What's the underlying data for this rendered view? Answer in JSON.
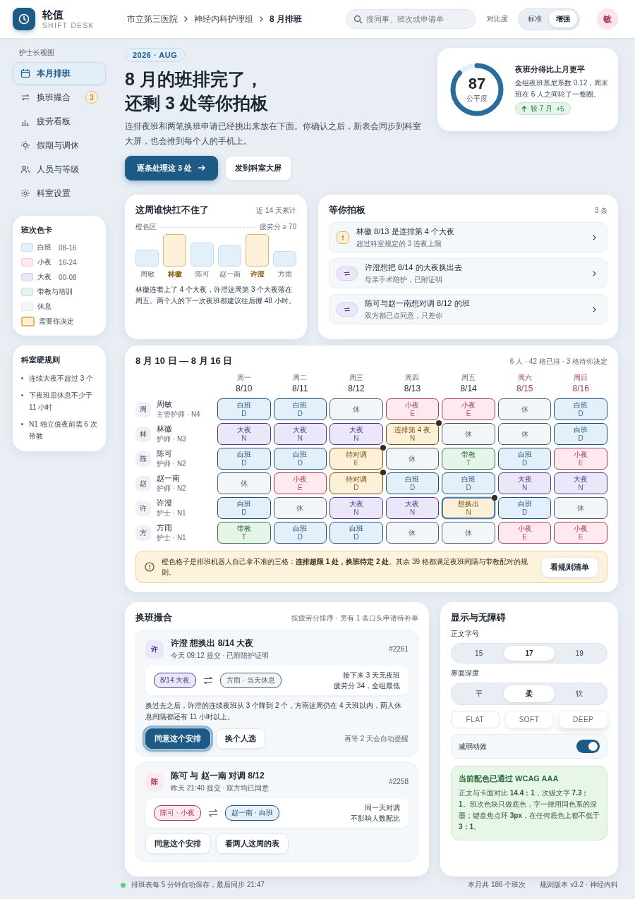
{
  "header": {
    "app_name": "轮值",
    "app_subtitle": "SHIFT DESK",
    "breadcrumbs": [
      "市立第三医院",
      "神经内科护理组",
      "8 月排班"
    ],
    "search": {
      "placeholder": "搜同事、班次或申请单"
    },
    "contrast_label": "对比度",
    "contrast_options": [
      {
        "label": "标准",
        "selected": false
      },
      {
        "label": "增强",
        "selected": true
      }
    ],
    "avatar": "敏"
  },
  "sidebar": {
    "section_label": "护士长视图",
    "nav": [
      {
        "label": "本月排班",
        "selected": true
      },
      {
        "label": "换班撮合",
        "selected": false,
        "badge": "3"
      },
      {
        "label": "疲劳看板",
        "selected": false
      },
      {
        "label": "假期与调休",
        "selected": false
      },
      {
        "label": "人员与等级",
        "selected": false
      },
      {
        "label": "科室设置",
        "selected": false
      }
    ],
    "legend": {
      "title": "班次色卡",
      "items": [
        {
          "kind": "day",
          "label": "白班",
          "hours": "08-16"
        },
        {
          "kind": "evening",
          "label": "小夜",
          "hours": "16-24"
        },
        {
          "kind": "night",
          "label": "大夜",
          "hours": "00-08"
        },
        {
          "kind": "teach",
          "label": "带教与培训"
        },
        {
          "kind": "rest",
          "label": "休息"
        },
        {
          "kind": "decide",
          "label": "需要你决定"
        }
      ]
    },
    "rules": {
      "title": "科室硬规则",
      "items": [
        "连续大夜不超过 3 个",
        "下夜班后休息不少于 11 小时",
        "N1 独立值夜前需 6 次带教"
      ]
    }
  },
  "hero": {
    "tag": "2026 · AUG",
    "title_lines": [
      "8 月的班排完了，",
      "还剩 3 处等你拍板"
    ],
    "description": "连排夜班和两笔换班申请已经挑出来放在下面。你确认之后，新表会同步到科室大屏，也会推到每个人的手机上。",
    "primary_button": "逐条处理这 3 处",
    "secondary_button": "发到科室大屏"
  },
  "score": {
    "value": "87",
    "label": "公平度",
    "level": 0.87,
    "title": "夜班分得比上月更平",
    "text": "全组夜班基尼系数 0.12，周末班在 6 人之间轮了一整圈。",
    "compare": "较 7 月",
    "delta": "+5"
  },
  "fatigue": {
    "title": "这周谁快扛不住了",
    "range": "近 14 天累计",
    "zone_label": "橙色区",
    "threshold_label": "疲劳分 ≥ 70",
    "bars": [
      {
        "name": "周敏",
        "over": false
      },
      {
        "name": "林徽",
        "over": true
      },
      {
        "name": "陈可",
        "over": false
      },
      {
        "name": "赵一南",
        "over": false
      },
      {
        "name": "许澄",
        "over": true
      },
      {
        "name": "方雨",
        "over": false
      }
    ],
    "note": "林徽连着上了 4 个大夜，许澄这周第 3 个大夜落在周五。两个人的下一次夜班都建议往后挪 48 小时。"
  },
  "pending": {
    "title": "等你拍板",
    "count": "3 条",
    "items": [
      {
        "kind": "warning",
        "title": "林徽 8/13 是连排第 4 个大夜",
        "sub": "超过科室规定的 3 连夜上限"
      },
      {
        "kind": "swap",
        "title": "许澄想把 8/14 的大夜换出去",
        "sub": "母亲手术陪护，已附证明"
      },
      {
        "kind": "swap",
        "title": "陈可与赵一南想对调 8/12 的班",
        "sub": "双方都已点同意，只差你"
      }
    ]
  },
  "schedule": {
    "title": "8 月 10 日 — 8 月 16 日",
    "summary": "6 人 · 42 格已排 · 3 格待你决定",
    "days": [
      {
        "weekday": "周一",
        "date": "8/10",
        "weekend": false
      },
      {
        "weekday": "周二",
        "date": "8/11",
        "weekend": false
      },
      {
        "weekday": "周三",
        "date": "8/12",
        "weekend": false
      },
      {
        "weekday": "周四",
        "date": "8/13",
        "weekend": false
      },
      {
        "weekday": "周五",
        "date": "8/14",
        "weekend": false
      },
      {
        "weekday": "周六",
        "date": "8/15",
        "weekend": true
      },
      {
        "weekday": "周日",
        "date": "8/16",
        "weekend": true
      }
    ],
    "rows": [
      {
        "avatar": "周",
        "name": "周敏",
        "role": "主管护师 · N4",
        "cells": [
          {
            "kind": "day",
            "label": "白班",
            "code": "D",
            "flagged": false,
            "focused": false
          },
          {
            "kind": "day",
            "label": "白班",
            "code": "D",
            "flagged": false,
            "focused": false
          },
          {
            "kind": "rest",
            "label": "休",
            "flagged": false,
            "focused": false
          },
          {
            "kind": "evening",
            "label": "小夜",
            "code": "E",
            "flagged": false,
            "focused": false
          },
          {
            "kind": "evening",
            "label": "小夜",
            "code": "E",
            "flagged": false,
            "focused": false
          },
          {
            "kind": "rest",
            "label": "休",
            "flagged": false,
            "focused": false
          },
          {
            "kind": "day",
            "label": "白班",
            "code": "D",
            "flagged": false,
            "focused": false
          }
        ]
      },
      {
        "avatar": "林",
        "name": "林徽",
        "role": "护师 · N3",
        "cells": [
          {
            "kind": "night",
            "label": "大夜",
            "code": "N",
            "flagged": false,
            "focused": false
          },
          {
            "kind": "night",
            "label": "大夜",
            "code": "N",
            "flagged": false,
            "focused": false
          },
          {
            "kind": "night",
            "label": "大夜",
            "code": "N",
            "flagged": false,
            "focused": false
          },
          {
            "kind": "decide",
            "label": "连排第 4 夜",
            "code": "N",
            "flagged": true,
            "focused": false
          },
          {
            "kind": "rest",
            "label": "休",
            "flagged": false,
            "focused": false
          },
          {
            "kind": "rest",
            "label": "休",
            "flagged": false,
            "focused": false
          },
          {
            "kind": "day",
            "label": "白班",
            "code": "D",
            "flagged": false,
            "focused": false
          }
        ]
      },
      {
        "avatar": "陈",
        "name": "陈可",
        "role": "护师 · N2",
        "cells": [
          {
            "kind": "day",
            "label": "白班",
            "code": "D",
            "flagged": false,
            "focused": false
          },
          {
            "kind": "day",
            "label": "白班",
            "code": "D",
            "flagged": false,
            "focused": false
          },
          {
            "kind": "decide",
            "label": "待对调",
            "code": "E",
            "flagged": true,
            "focused": false
          },
          {
            "kind": "rest",
            "label": "休",
            "flagged": false,
            "focused": false
          },
          {
            "kind": "teach",
            "label": "带教",
            "code": "T",
            "flagged": false,
            "focused": false
          },
          {
            "kind": "day",
            "label": "白班",
            "code": "D",
            "flagged": false,
            "focused": false
          },
          {
            "kind": "evening",
            "label": "小夜",
            "code": "E",
            "flagged": false,
            "focused": false
          }
        ]
      },
      {
        "avatar": "赵",
        "name": "赵一南",
        "role": "护师 · N2",
        "cells": [
          {
            "kind": "rest",
            "label": "休",
            "flagged": false,
            "focused": false
          },
          {
            "kind": "evening",
            "label": "小夜",
            "code": "E",
            "flagged": false,
            "focused": false
          },
          {
            "kind": "decide",
            "label": "待对调",
            "code": "D",
            "flagged": true,
            "focused": false
          },
          {
            "kind": "day",
            "label": "白班",
            "code": "D",
            "flagged": false,
            "focused": false
          },
          {
            "kind": "day",
            "label": "白班",
            "code": "D",
            "flagged": false,
            "focused": false
          },
          {
            "kind": "night",
            "label": "大夜",
            "code": "N",
            "flagged": false,
            "focused": false
          },
          {
            "kind": "night",
            "label": "大夜",
            "code": "N",
            "flagged": false,
            "focused": false
          }
        ]
      },
      {
        "avatar": "许",
        "name": "许澄",
        "role": "护士 · N1",
        "cells": [
          {
            "kind": "day",
            "label": "白班",
            "code": "D",
            "flagged": false,
            "focused": false
          },
          {
            "kind": "rest",
            "label": "休",
            "flagged": false,
            "focused": false
          },
          {
            "kind": "night",
            "label": "大夜",
            "code": "N",
            "flagged": false,
            "focused": false
          },
          {
            "kind": "night",
            "label": "大夜",
            "code": "N",
            "flagged": false,
            "focused": false
          },
          {
            "kind": "decide",
            "label": "想换出",
            "code": "N",
            "flagged": true,
            "focused": true
          },
          {
            "kind": "day",
            "label": "白班",
            "code": "D",
            "flagged": false,
            "focused": false
          },
          {
            "kind": "rest",
            "label": "休",
            "flagged": false,
            "focused": false
          }
        ]
      },
      {
        "avatar": "方",
        "name": "方雨",
        "role": "护士 · N1",
        "cells": [
          {
            "kind": "teach",
            "label": "带教",
            "code": "T",
            "flagged": false,
            "focused": false
          },
          {
            "kind": "day",
            "label": "白班",
            "code": "D",
            "flagged": false,
            "focused": false
          },
          {
            "kind": "day",
            "label": "白班",
            "code": "D",
            "flagged": false,
            "focused": false
          },
          {
            "kind": "rest",
            "label": "休",
            "flagged": false,
            "focused": false
          },
          {
            "kind": "rest",
            "label": "休",
            "flagged": false,
            "focused": false
          },
          {
            "kind": "evening",
            "label": "小夜",
            "code": "E",
            "flagged": false,
            "focused": false
          },
          {
            "kind": "evening",
            "label": "小夜",
            "code": "E",
            "flagged": false,
            "focused": false
          }
        ]
      }
    ],
    "notice": "橙色格子是排班机器人自己拿不准的三格：**连排超限 1 处，换班待定 2 处**。其余 39 格都满足夜班间隔与带教配对的规则。",
    "notice_button": "看规则清单"
  },
  "swaps": {
    "title": "换班撮合",
    "meta": "按疲劳分排序 · 另有 1 条口头申请待补单",
    "requests": [
      {
        "avatar": "许",
        "title": "许澄 想换出 8/14 大夜",
        "sub": "今天 09:12 提交 · 已附陪护证明",
        "id": "#2261",
        "from": {
          "label": "8/14 大夜",
          "kind": "night"
        },
        "to": {
          "label": "方雨 · 当天休息",
          "kind": "rest"
        },
        "notes": [
          "接下来 3 天无夜班",
          "疲劳分 34，全组最低"
        ],
        "explanation": "换过去之后，许澄的连续夜班从 3 个降到 2 个，方雨这周仍在 4 天班以内，两人休息间隔都还有 11 小时以上。",
        "buttons": [
          {
            "label": "同意这个安排",
            "primary": true
          },
          {
            "label": "换个人选",
            "primary": false
          }
        ],
        "hint": "再等 2 天会自动提醒"
      },
      {
        "avatar": "陈",
        "title": "陈可 与 赵一南 对调 8/12",
        "sub": "昨天 21:40 提交 · 双方均已同意",
        "id": "#2258",
        "from": {
          "label": "陈可 · 小夜",
          "kind": "evening"
        },
        "to": {
          "label": "赵一南 · 白班",
          "kind": "day"
        },
        "notes": [
          "同一天对调",
          "不影响人数配比"
        ],
        "buttons": [
          {
            "label": "同意这个安排",
            "primary": false
          },
          {
            "label": "看两人这周的表",
            "primary": false
          }
        ]
      }
    ]
  },
  "display": {
    "title": "显示与无障碍",
    "font_label": "正文字号",
    "font_options": [
      {
        "label": "15",
        "selected": false
      },
      {
        "label": "17",
        "selected": true
      },
      {
        "label": "19",
        "selected": false
      }
    ],
    "depth_label": "界面深度",
    "depth_options": [
      {
        "label": "平",
        "selected": false
      },
      {
        "label": "柔",
        "selected": true
      },
      {
        "label": "软",
        "selected": false
      }
    ],
    "depth_previews": [
      {
        "kind": "flat",
        "label": "FLAT"
      },
      {
        "kind": "soft",
        "label": "SOFT"
      },
      {
        "kind": "deep",
        "label": "DEEP"
      }
    ],
    "reduce_motion": {
      "label": "减弱动效",
      "on": true
    },
    "notice_title": "当前配色已通过 WCAG AAA",
    "notice_text": "正文与卡面对比 **14.4：1**，次级文字 **7.3：1**。班次色块只做底色，字一律用同色系的深墨；键盘焦点环 **3px**，在任何底色上都不低于 **3：1**。"
  },
  "footer": {
    "status": "排班表每 5 分钟自动保存，最后同步 21:47",
    "shift_count": "本月共 186 个班次",
    "version": "规则版本 v3.2 · 神经内科"
  }
}
